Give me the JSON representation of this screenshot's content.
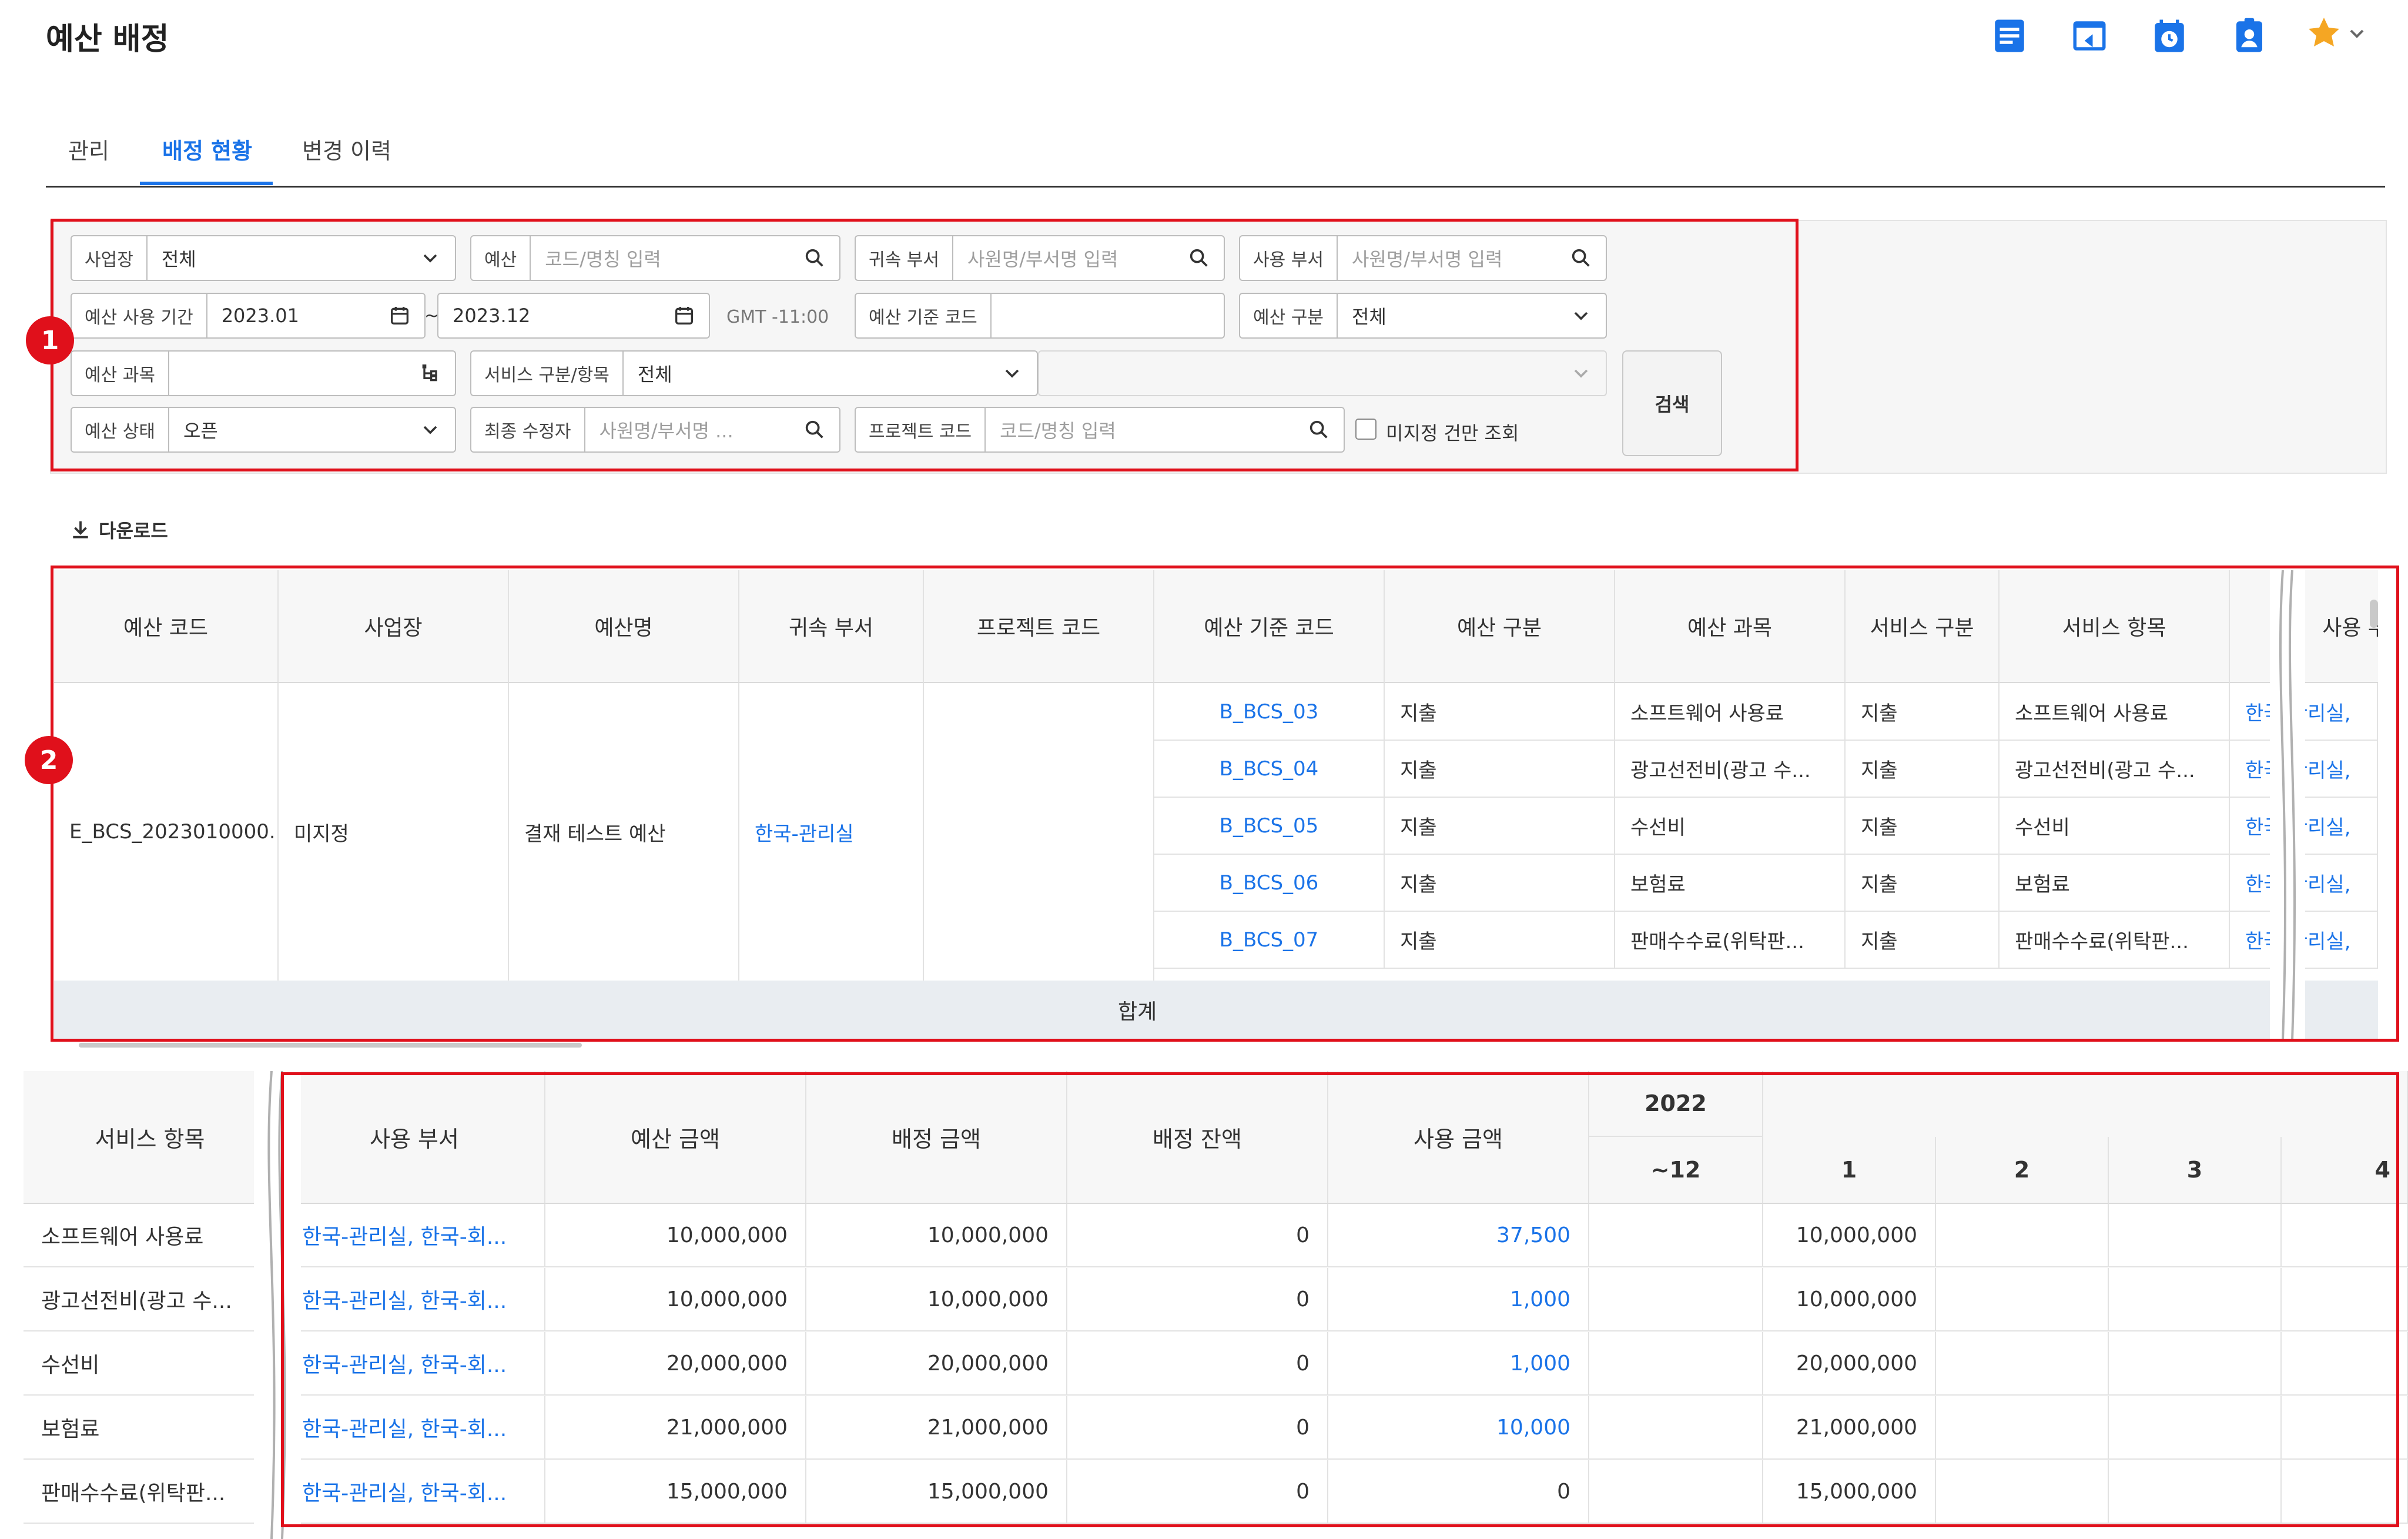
{
  "page": {
    "title": "예산 배정"
  },
  "header_icons": [
    "document-icon",
    "browser-window-icon",
    "calendar-clock-icon",
    "clipboard-user-icon",
    "star-icon",
    "chevron-down-icon"
  ],
  "colors": {
    "accent": "#1a73e8",
    "annotation": "#e0101b",
    "favorite": "#f5a623"
  },
  "tabs": [
    {
      "label": "관리",
      "active": false
    },
    {
      "label": "배정 현황",
      "active": true
    },
    {
      "label": "변경 이력",
      "active": false
    }
  ],
  "filters": {
    "site": {
      "label": "사업장",
      "value": "전체"
    },
    "budget": {
      "label": "예산",
      "placeholder": "코드/명칭 입력"
    },
    "owner_dept": {
      "label": "귀속 부서",
      "placeholder": "사원명/부서명 입력"
    },
    "use_dept": {
      "label": "사용 부서",
      "placeholder": "사원명/부서명 입력"
    },
    "period": {
      "label": "예산 사용 기간",
      "from": "2023.01",
      "separator": "~",
      "to": "2023.12",
      "timezone": "GMT -11:00"
    },
    "base_code": {
      "label": "예산 기준 코드",
      "value": ""
    },
    "budget_type": {
      "label": "예산 구분",
      "value": "전체"
    },
    "account": {
      "label": "예산 과목",
      "value": ""
    },
    "service": {
      "label": "서비스 구분/항목",
      "value": "전체",
      "sub_value": ""
    },
    "status": {
      "label": "예산 상태",
      "value": "오픈"
    },
    "modifier": {
      "label": "최종 수정자",
      "placeholder": "사원명/부서명 ..."
    },
    "project": {
      "label": "프로젝트 코드",
      "placeholder": "코드/명칭 입력"
    },
    "unassigned_only": {
      "label": "미지정 건만 조회",
      "checked": false
    },
    "search_label": "검색"
  },
  "annotations": {
    "badge1": "1",
    "badge2": "2"
  },
  "download_label": "다운로드",
  "table1": {
    "headers": [
      "예산 코드",
      "사업장",
      "예산명",
      "귀속 부서",
      "프로젝트 코드",
      "예산 기준 코드",
      "예산 구분",
      "예산 과목",
      "서비스 구분",
      "서비스 항목",
      "사용 부"
    ],
    "group": {
      "code": "E_BCS_2023010000...",
      "site": "미지정",
      "name": "결재 테스트 예산",
      "dept": "한국-관리실",
      "project": ""
    },
    "rows": [
      {
        "base_code": "B_BCS_03",
        "type": "지출",
        "account": "소프트웨어 사용료",
        "svc_type": "지출",
        "svc_item": "소프트웨어 사용료",
        "use_dept": "한국-관리실,"
      },
      {
        "base_code": "B_BCS_04",
        "type": "지출",
        "account": "광고선전비(광고 수...",
        "svc_type": "지출",
        "svc_item": "광고선전비(광고 수...",
        "use_dept": "한국-관리실,"
      },
      {
        "base_code": "B_BCS_05",
        "type": "지출",
        "account": "수선비",
        "svc_type": "지출",
        "svc_item": "수선비",
        "use_dept": "한국-관리실,"
      },
      {
        "base_code": "B_BCS_06",
        "type": "지출",
        "account": "보험료",
        "svc_type": "지출",
        "svc_item": "보험료",
        "use_dept": "한국-관리실,"
      },
      {
        "base_code": "B_BCS_07",
        "type": "지출",
        "account": "판매수수료(위탁판...",
        "svc_type": "지출",
        "svc_item": "판매수수료(위탁판...",
        "use_dept": "한국-관리실,"
      }
    ],
    "total_label": "합계"
  },
  "table2": {
    "headers": {
      "service_item": "서비스 항목",
      "use_dept": "사용 부서",
      "budget_amount": "예산 금액",
      "allocated_amount": "배정 금액",
      "allocation_balance": "배정 잔액",
      "used_amount": "사용 금액",
      "year": "2022",
      "months": [
        "~12",
        "1",
        "2",
        "3",
        "4"
      ]
    },
    "rows": [
      {
        "service_item": "소프트웨어 사용료",
        "use_dept": "한국-관리실, 한국-회...",
        "budget": "10,000,000",
        "allocated": "10,000,000",
        "balance": "0",
        "used": "37,500",
        "used_link": true,
        "m_prev": "",
        "m1": "10,000,000",
        "m2": "",
        "m3": "",
        "m4": ""
      },
      {
        "service_item": "광고선전비(광고 수...",
        "use_dept": "한국-관리실, 한국-회...",
        "budget": "10,000,000",
        "allocated": "10,000,000",
        "balance": "0",
        "used": "1,000",
        "used_link": true,
        "m_prev": "",
        "m1": "10,000,000",
        "m2": "",
        "m3": "",
        "m4": ""
      },
      {
        "service_item": "수선비",
        "use_dept": "한국-관리실, 한국-회...",
        "budget": "20,000,000",
        "allocated": "20,000,000",
        "balance": "0",
        "used": "1,000",
        "used_link": true,
        "m_prev": "",
        "m1": "20,000,000",
        "m2": "",
        "m3": "",
        "m4": ""
      },
      {
        "service_item": "보험료",
        "use_dept": "한국-관리실, 한국-회...",
        "budget": "21,000,000",
        "allocated": "21,000,000",
        "balance": "0",
        "used": "10,000",
        "used_link": true,
        "m_prev": "",
        "m1": "21,000,000",
        "m2": "",
        "m3": "",
        "m4": ""
      },
      {
        "service_item": "판매수수료(위탁판...",
        "use_dept": "한국-관리실, 한국-회...",
        "budget": "15,000,000",
        "allocated": "15,000,000",
        "balance": "0",
        "used": "0",
        "used_link": false,
        "m_prev": "",
        "m1": "15,000,000",
        "m2": "",
        "m3": "",
        "m4": ""
      }
    ]
  }
}
